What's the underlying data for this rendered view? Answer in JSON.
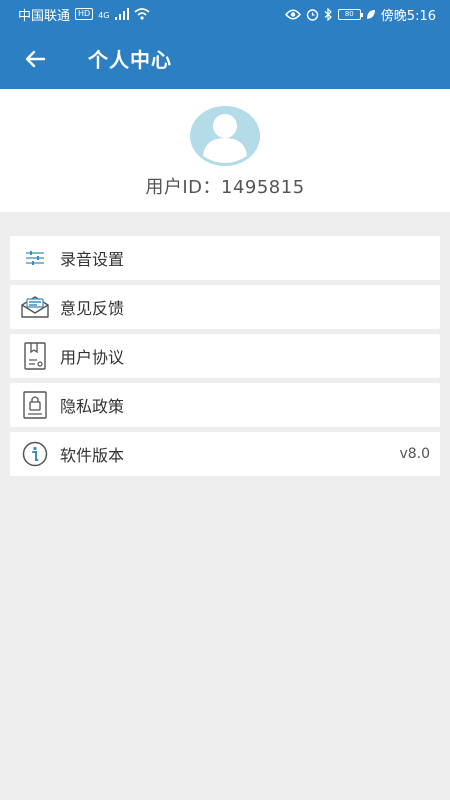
{
  "status_bar": {
    "carrier": "中国联通",
    "network_badge": "HD",
    "signal_label": "4G",
    "battery": "80",
    "time": "傍晚5:16"
  },
  "header": {
    "title": "个人中心",
    "back_icon": "arrow-left-icon"
  },
  "profile": {
    "avatar_icon": "user-avatar-icon",
    "user_id": "用户ID：1495815"
  },
  "menu": {
    "items": [
      {
        "label": "录音设置",
        "icon": "sliders-icon",
        "value": ""
      },
      {
        "label": "意见反馈",
        "icon": "mail-feedback-icon",
        "value": ""
      },
      {
        "label": "用户协议",
        "icon": "document-icon",
        "value": ""
      },
      {
        "label": "隐私政策",
        "icon": "lock-document-icon",
        "value": ""
      },
      {
        "label": "软件版本",
        "icon": "info-icon",
        "value": "v8.0"
      }
    ]
  },
  "colors": {
    "header_bg": "#2c7fc2",
    "page_bg": "#eeeeee",
    "avatar": "#b3dbe8",
    "icon": "#3c8dbc"
  }
}
